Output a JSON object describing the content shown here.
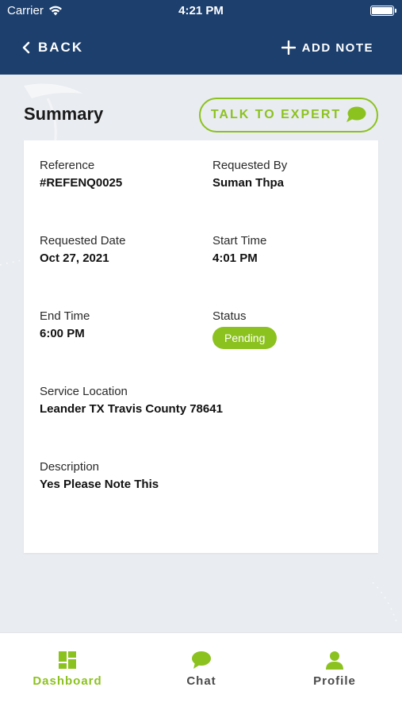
{
  "status_bar": {
    "carrier": "Carrier",
    "time": "4:21 PM",
    "wifi_icon": "wifi-icon",
    "battery_icon": "battery-icon"
  },
  "header": {
    "back_label": "BACK",
    "add_note_label": "ADD NOTE",
    "background_color": "#1c3f6e"
  },
  "summary": {
    "title": "Summary",
    "talk_button_label": "TALK TO EXPERT",
    "accent_color": "#8cc21f"
  },
  "details": {
    "reference_label": "Reference",
    "reference_value": "#REFENQ0025",
    "requested_by_label": "Requested By",
    "requested_by_value": "Suman Thpa",
    "requested_date_label": "Requested Date",
    "requested_date_value": "Oct 27, 2021",
    "start_time_label": "Start Time",
    "start_time_value": "4:01 PM",
    "end_time_label": "End Time",
    "end_time_value": "6:00 PM",
    "status_label": "Status",
    "status_value": "Pending",
    "service_location_label": "Service Location",
    "service_location_value": "Leander TX Travis County 78641",
    "description_label": "Description",
    "description_value": "Yes Please Note This"
  },
  "tabbar": {
    "items": [
      {
        "label": "Dashboard",
        "icon": "dashboard-icon",
        "active": true
      },
      {
        "label": "Chat",
        "icon": "chat-icon",
        "active": false
      },
      {
        "label": "Profile",
        "icon": "profile-icon",
        "active": false
      }
    ]
  }
}
